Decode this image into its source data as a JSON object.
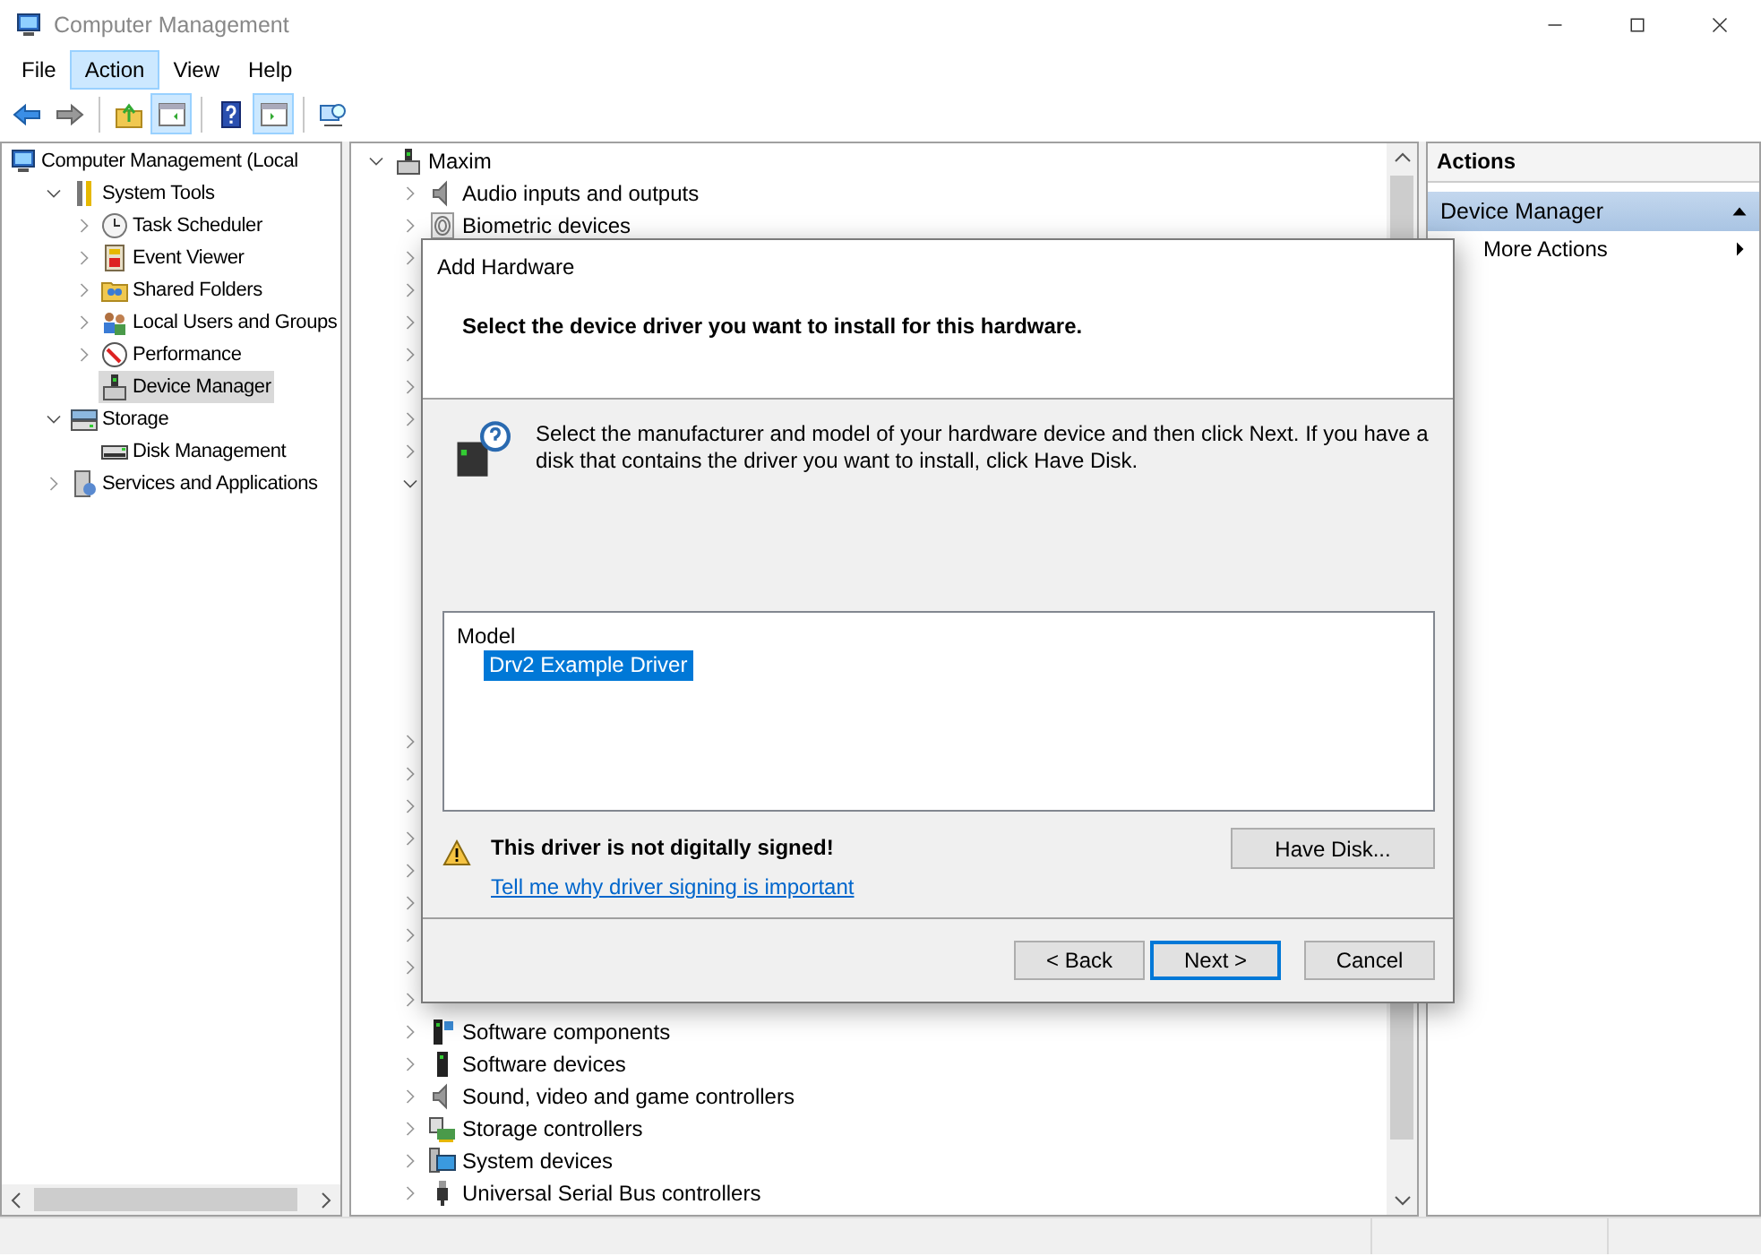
{
  "window": {
    "title": "Computer Management"
  },
  "menu": [
    {
      "label": "File",
      "selected": false
    },
    {
      "label": "Action",
      "selected": true
    },
    {
      "label": "View",
      "selected": false
    },
    {
      "label": "Help",
      "selected": false
    }
  ],
  "toolbar": [
    {
      "pressed": false
    },
    {
      "pressed": false
    },
    {
      "pressed": false
    },
    {
      "pressed": true
    },
    {
      "pressed": false
    },
    {
      "pressed": true
    },
    {
      "pressed": false
    }
  ],
  "console_tree": {
    "items": [
      {
        "label": "Computer Management (Local",
        "selected": false,
        "children": [
          {
            "label": "System Tools",
            "selected": false,
            "expanded": true,
            "children": [
              {
                "label": "Task Scheduler",
                "selected": false,
                "expanded": false
              },
              {
                "label": "Event Viewer",
                "selected": false,
                "expanded": false
              },
              {
                "label": "Shared Folders",
                "selected": false,
                "expanded": false
              },
              {
                "label": "Local Users and Groups",
                "selected": false,
                "expanded": false
              },
              {
                "label": "Performance",
                "selected": false,
                "expanded": false
              },
              {
                "label": "Device Manager",
                "selected": true
              }
            ]
          },
          {
            "label": "Storage",
            "selected": false,
            "expanded": true,
            "children": [
              {
                "label": "Disk Management",
                "selected": false
              }
            ]
          },
          {
            "label": "Services and Applications",
            "selected": false,
            "expanded": false
          }
        ]
      }
    ]
  },
  "device_tree": {
    "items": [
      {
        "label": "Maxim",
        "expanded": true,
        "children": [
          {
            "label": "Audio inputs and outputs",
            "expanded": false
          },
          {
            "label": "Biometric devices",
            "expanded": false
          },
          {
            "expanded": false
          },
          {
            "expanded": false
          },
          {
            "expanded": false
          },
          {
            "expanded": false
          },
          {
            "expanded": false
          },
          {
            "expanded": false
          },
          {
            "expanded": false
          },
          {
            "expanded": true
          },
          {
            "expanded": false
          },
          {
            "expanded": false
          },
          {
            "expanded": false
          },
          {
            "expanded": false
          },
          {
            "expanded": false
          },
          {
            "expanded": false
          },
          {
            "expanded": false
          },
          {
            "expanded": false
          },
          {
            "expanded": false
          },
          {
            "label": "Software components",
            "expanded": false
          },
          {
            "label": "Software devices",
            "expanded": false
          },
          {
            "label": "Sound, video and game controllers",
            "expanded": false
          },
          {
            "label": "Storage controllers",
            "expanded": false
          },
          {
            "label": "System devices",
            "expanded": false
          },
          {
            "label": "Universal Serial Bus controllers",
            "expanded": false
          }
        ]
      }
    ]
  },
  "actions_pane": {
    "title": "Actions",
    "sections": [
      {
        "title": "Device Manager",
        "expanded": true,
        "items": [
          {
            "label": "More Actions"
          }
        ]
      }
    ]
  },
  "dialog": {
    "title": "Add Hardware",
    "heading": "Select the device driver you want to install for this hardware.",
    "description": "Select the manufacturer and model of your hardware device and then click Next. If you have a disk that contains the driver you want to install, click Have Disk.",
    "model_list": {
      "header": "Model",
      "items": [
        {
          "label": "Drv2 Example Driver",
          "selected": true
        }
      ]
    },
    "warning": "This driver is not digitally signed!",
    "link": "Tell me why driver signing is important",
    "have_disk_button": "Have Disk...",
    "buttons": [
      {
        "label": "< Back",
        "default": false
      },
      {
        "label": "Next >",
        "default": true
      },
      {
        "label": "Cancel",
        "default": false
      }
    ]
  }
}
